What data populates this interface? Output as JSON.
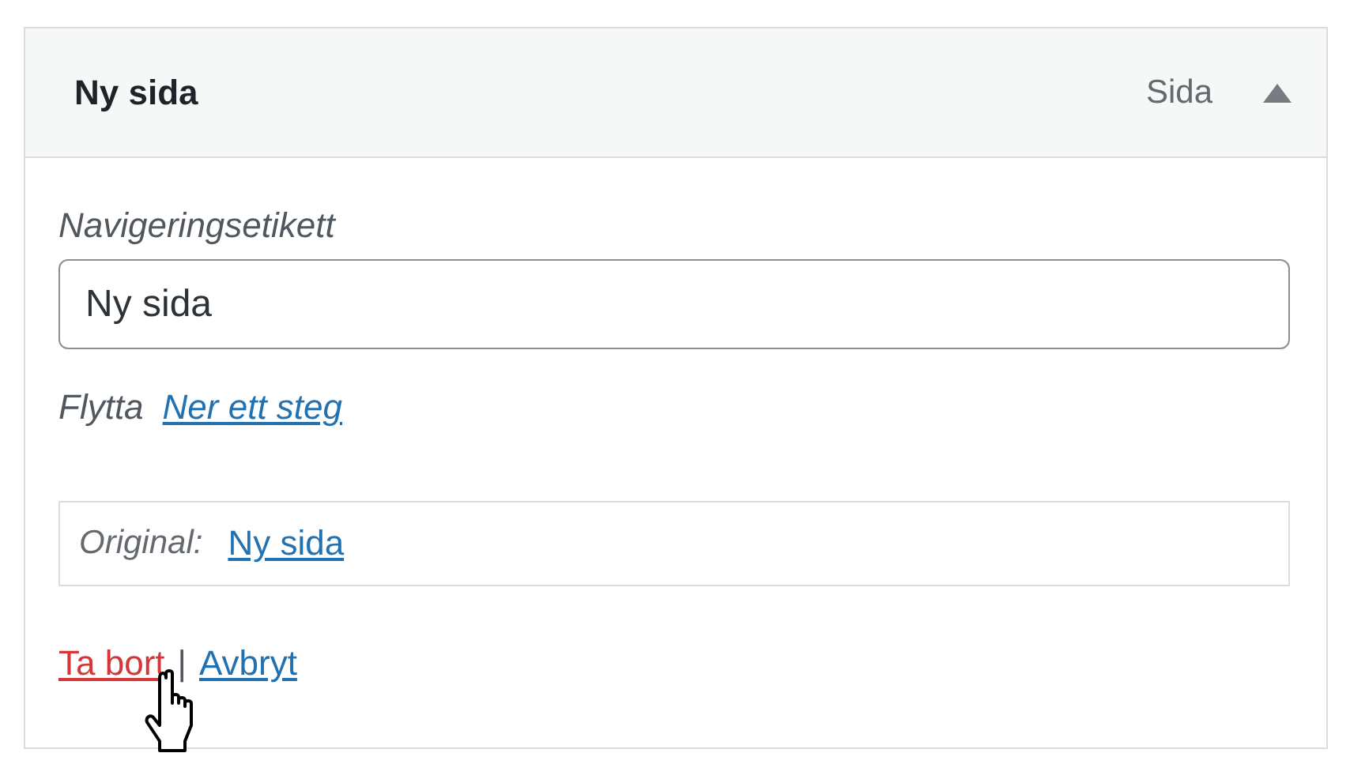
{
  "header": {
    "title": "Ny sida",
    "type_label": "Sida",
    "expanded": true
  },
  "label_field": {
    "label": "Navigeringsetikett",
    "value": "Ny sida"
  },
  "move": {
    "label": "Flytta",
    "links": [
      "Ner ett steg"
    ]
  },
  "original": {
    "label": "Original:",
    "link": "Ny sida"
  },
  "actions": [
    {
      "label": "Ta bort",
      "kind": "delete"
    },
    {
      "label": "Avbryt",
      "kind": "cancel"
    }
  ],
  "separator": "|"
}
